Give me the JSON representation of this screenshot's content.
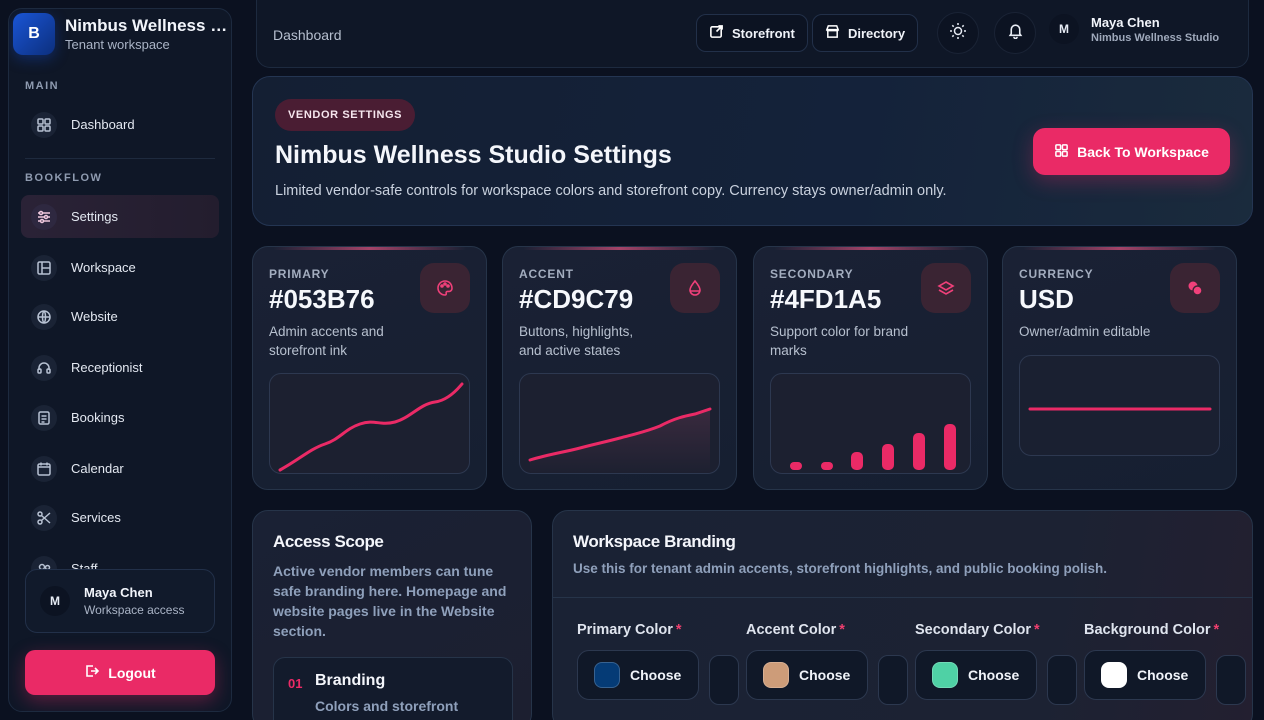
{
  "brand": {
    "initial": "B",
    "title": "Nimbus Wellness Studio",
    "subtitle": "Tenant workspace"
  },
  "sidebar": {
    "section_main": "MAIN",
    "section_bookflow": "BOOKFLOW",
    "main_items": [
      {
        "label": "Dashboard",
        "icon": "dashboard-icon"
      }
    ],
    "bookflow_items": [
      {
        "label": "Settings",
        "icon": "sliders-icon",
        "active": true
      },
      {
        "label": "Workspace",
        "icon": "layout-icon"
      },
      {
        "label": "Website",
        "icon": "globe-icon"
      },
      {
        "label": "Receptionist",
        "icon": "headset-icon"
      },
      {
        "label": "Bookings",
        "icon": "list-icon"
      },
      {
        "label": "Calendar",
        "icon": "calendar-icon"
      },
      {
        "label": "Services",
        "icon": "scissors-icon"
      },
      {
        "label": "Staff",
        "icon": "users-icon"
      }
    ],
    "user": {
      "initial": "M",
      "name": "Maya Chen",
      "role": "Workspace access"
    },
    "logout_label": "Logout"
  },
  "topbar": {
    "breadcrumb": "Dashboard",
    "storefront_label": "Storefront",
    "directory_label": "Directory",
    "user": {
      "initial": "M",
      "name": "Maya Chen",
      "org": "Nimbus Wellness Studio"
    }
  },
  "hero": {
    "badge": "VENDOR SETTINGS",
    "title": "Nimbus Wellness Studio Settings",
    "description": "Limited vendor-safe controls for workspace colors and storefront copy. Currency stays owner/admin only.",
    "back_button": "Back To Workspace"
  },
  "stats": [
    {
      "label": "PRIMARY",
      "value": "#053B76",
      "desc": "Admin accents and storefront ink",
      "icon": "palette-icon"
    },
    {
      "label": "ACCENT",
      "value": "#CD9C79",
      "desc": "Buttons, highlights, and active states",
      "icon": "droplet-icon"
    },
    {
      "label": "SECONDARY",
      "value": "#4FD1A5",
      "desc": "Support color for brand marks",
      "icon": "layers-icon"
    },
    {
      "label": "CURRENCY",
      "value": "USD",
      "desc": "Owner/admin editable",
      "icon": "coins-icon"
    }
  ],
  "access": {
    "title": "Access Scope",
    "description": "Active vendor members can tune safe branding here. Homepage and website pages live in the Website section.",
    "item": {
      "number": "01",
      "title": "Branding",
      "subtitle": "Colors and storefront"
    }
  },
  "branding": {
    "title": "Workspace Branding",
    "description": "Use this for tenant admin accents, storefront highlights, and public booking polish.",
    "fields": [
      {
        "label": "Primary Color",
        "button": "Choose",
        "color": "#053B76"
      },
      {
        "label": "Accent Color",
        "button": "Choose",
        "color": "#CD9C79"
      },
      {
        "label": "Secondary Color",
        "button": "Choose",
        "color": "#4FD1A5"
      },
      {
        "label": "Background Color",
        "button": "Choose",
        "color": "#FFFFFF"
      }
    ],
    "required_mark": "*"
  },
  "colors": {
    "accent": "#EA2A66",
    "background": "#0B1120"
  }
}
